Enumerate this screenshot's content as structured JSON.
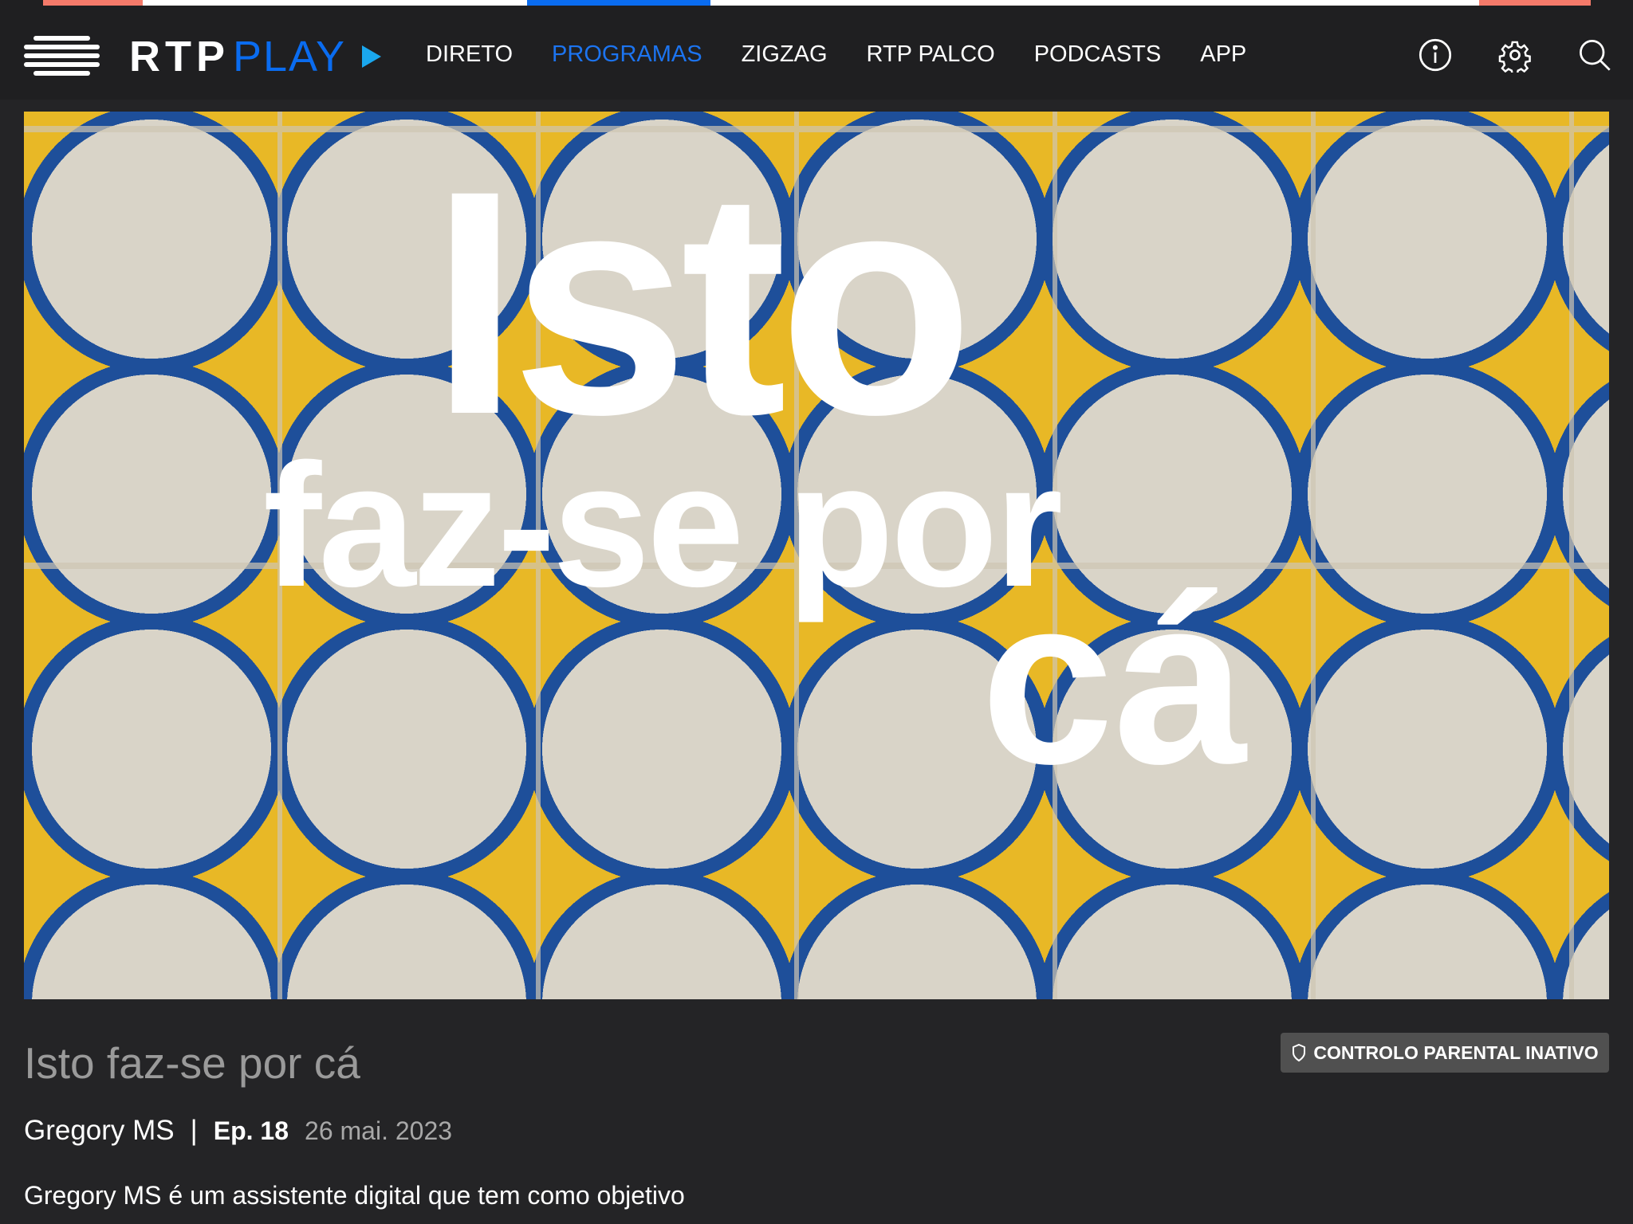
{
  "nav": {
    "logo_rtp": "RTP",
    "logo_play": "PLAY",
    "items": [
      {
        "label": "DIRETO"
      },
      {
        "label": "PROGRAMAS",
        "active": true
      },
      {
        "label": "ZIGZAG"
      },
      {
        "label": "RTP PALCO"
      },
      {
        "label": "PODCASTS"
      },
      {
        "label": "APP"
      }
    ],
    "icons": [
      "info-icon",
      "gear-icon",
      "search-icon"
    ]
  },
  "hero": {
    "line1": "Isto",
    "line2": "faz-se por",
    "line3": "cá"
  },
  "program": {
    "title": "Isto faz-se por cá",
    "episode_title": "Gregory MS",
    "separator": "|",
    "episode": "Ep. 18",
    "date": "26 mai. 2023",
    "description": "Gregory MS é um assistente digital que tem como objetivo"
  },
  "badge": {
    "label": "CONTROLO PARENTAL INATIVO"
  },
  "colors": {
    "accent": "#0a6cf0",
    "background": "#242426",
    "nav": "#1f1f21"
  }
}
